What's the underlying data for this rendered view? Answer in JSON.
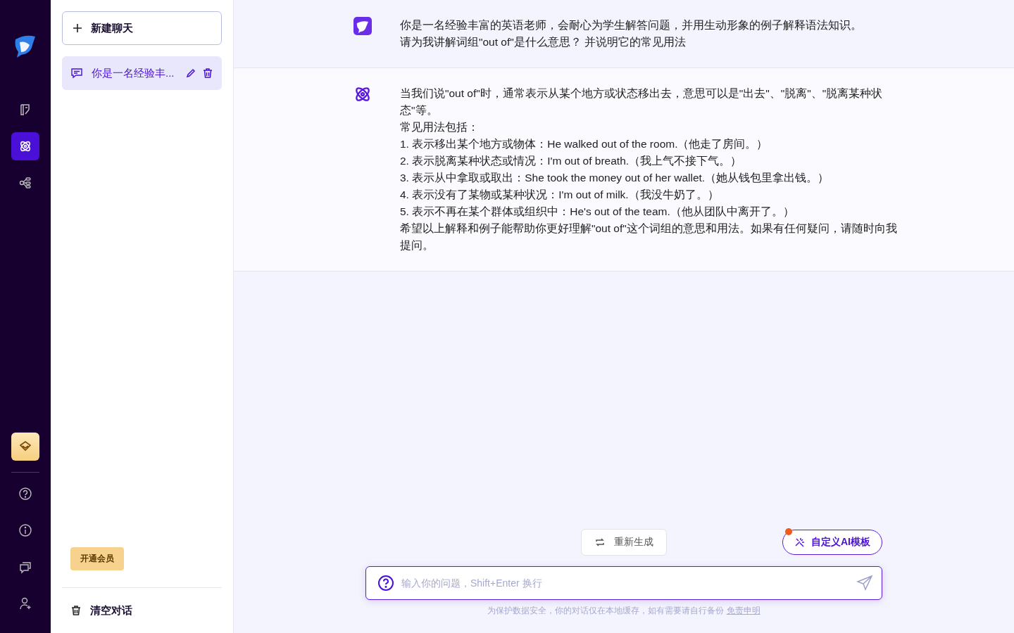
{
  "nav_rail": {
    "items": [
      {
        "selected": false
      },
      {
        "selected": true
      },
      {
        "selected": false
      }
    ]
  },
  "sidebar": {
    "new_chat": "新建聊天",
    "chats": [
      {
        "title": "你是一名经验丰...",
        "selected": true
      }
    ],
    "vip_badge": "开通会员",
    "clear": "清空对话"
  },
  "messages": [
    {
      "kind": "user",
      "lines": [
        "你是一名经验丰富的英语老师，会耐心为学生解答问题，并用生动形象的例子解释语法知识。",
        "请为我讲解词组\"out of\"是什么意思？ 并说明它的常见用法"
      ]
    },
    {
      "kind": "bot",
      "lines": [
        "当我们说\"out of\"时，通常表示从某个地方或状态移出去，意思可以是\"出去\"、\"脱离\"、\"脱离某种状态\"等。",
        "常见用法包括：",
        "1. 表示移出某个地方或物体：He walked out of the room.（他走了房间。）",
        "2. 表示脱离某种状态或情况：I'm out of breath.（我上气不接下气。）",
        "3. 表示从中拿取或取出：She took the money out of her wallet.（她从钱包里拿出钱。）",
        "4. 表示没有了某物或某种状况：I'm out of milk.（我没牛奶了。）",
        "5. 表示不再在某个群体或组织中：He's out of the team.（他从团队中离开了。）",
        "希望以上解释和例子能帮助你更好理解\"out of\"这个词组的意思和用法。如果有任何疑问，请随时向我提问。"
      ]
    }
  ],
  "regenerate": "重新生成",
  "template_button": "自定义AI模板",
  "input": {
    "placeholder": "输入你的问题，Shift+Enter 换行"
  },
  "footer": {
    "note": "为保护数据安全，你的对话仅在本地缓存，如有需要请自行备份",
    "link": "免责申明"
  }
}
